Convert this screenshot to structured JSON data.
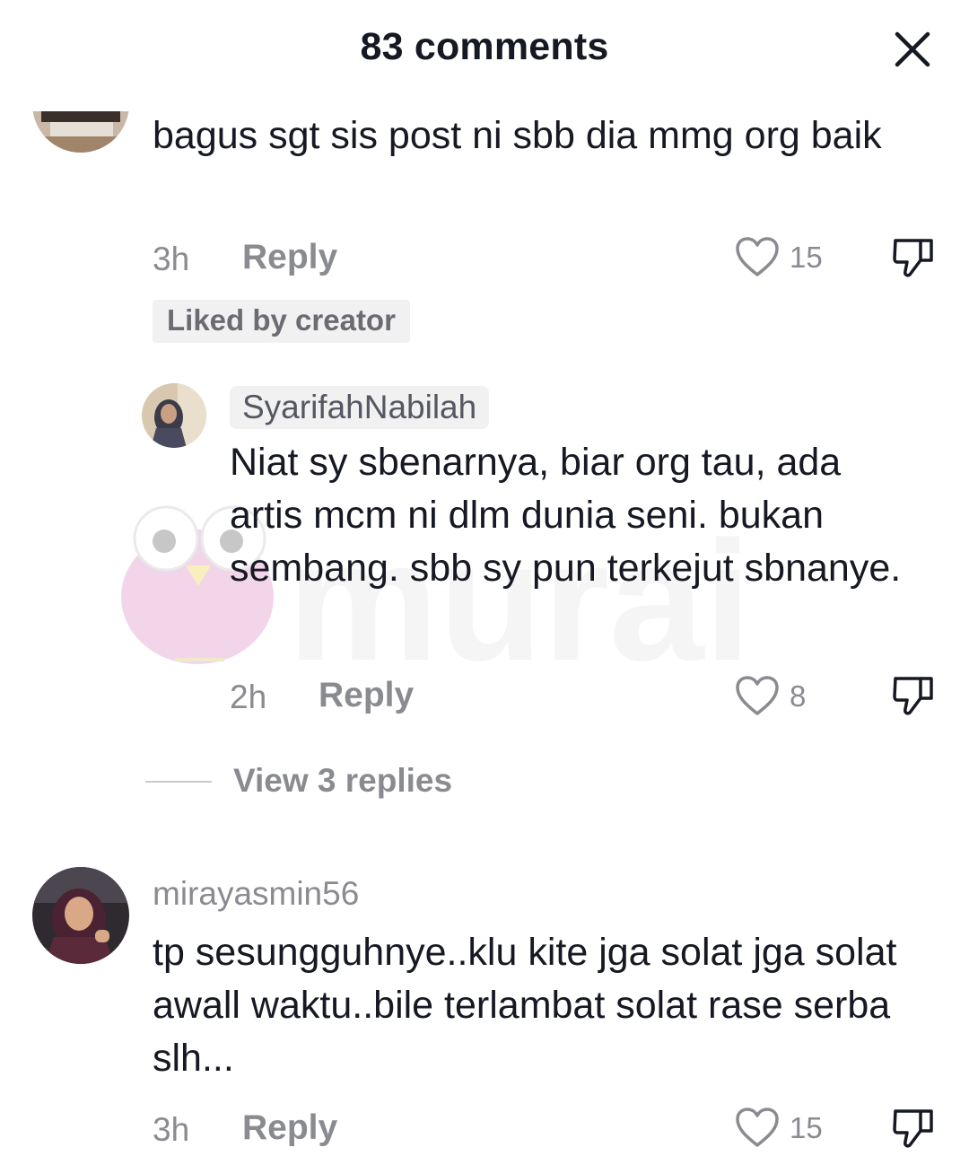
{
  "header": {
    "title": "83 comments",
    "close_icon": "close-icon"
  },
  "comments": [
    {
      "username": "",
      "text": "bagus sgt sis post ni sbb dia mmg org baik",
      "time": "3h",
      "reply_label": "Reply",
      "likes": "15",
      "badge": "Liked by creator"
    },
    {
      "username": "SyarifahNabilah",
      "text": "Niat sy sbenarnya, biar org tau, ada artis mcm ni dlm dunia seni. bukan sembang. sbb sy pun terkejut sbnanye.",
      "time": "2h",
      "reply_label": "Reply",
      "likes": "8"
    },
    {
      "username": "mirayasmin56",
      "text": "tp sesungguhnye..klu kite jga solat jga solat awall waktu..bile terlambat solat rase serba slh...",
      "time": "3h",
      "reply_label": "Reply",
      "likes": "15"
    }
  ],
  "view_replies": "View 3 replies",
  "watermark_text": "murai",
  "colors": {
    "text": "#161823",
    "muted": "#8a8b91",
    "chip_bg": "#f1f1f2",
    "watermark_pink": "#e8b4d8"
  }
}
